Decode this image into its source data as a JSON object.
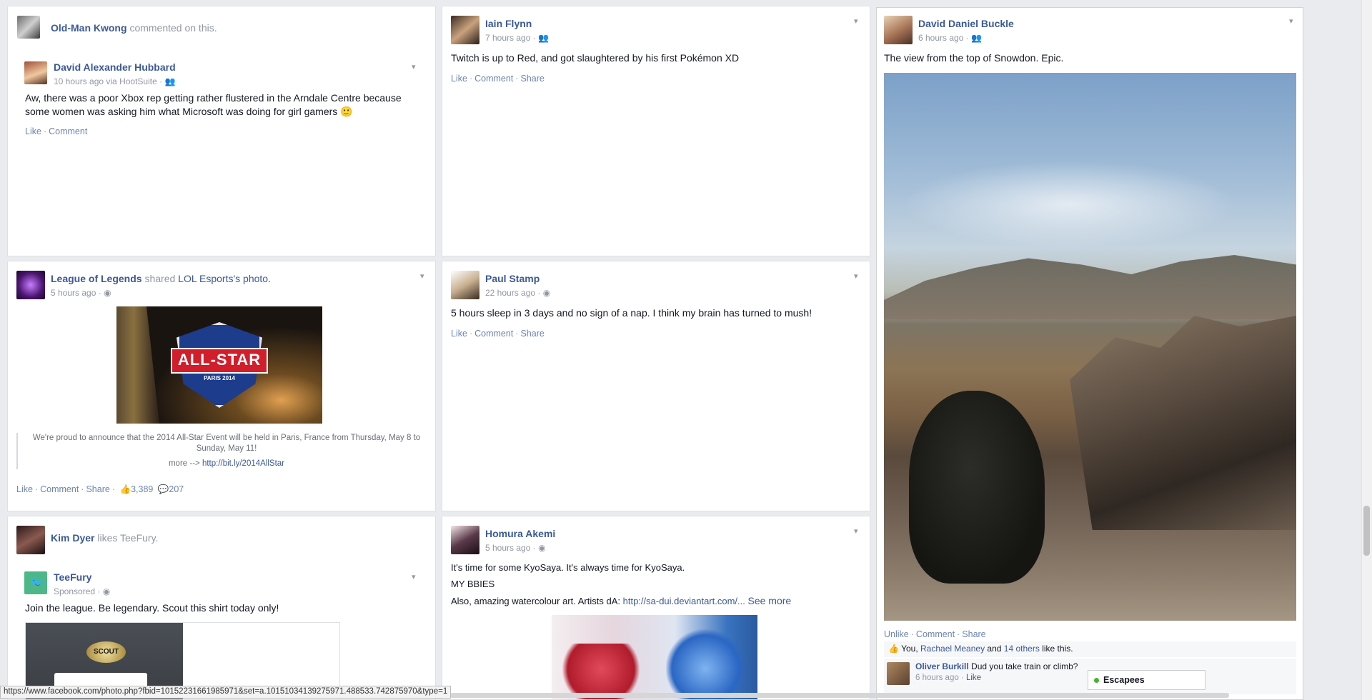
{
  "feed": {
    "c1": {
      "actor": "Old-Man Kwong",
      "actor_action": "commented on this.",
      "author": "David Alexander Hubbard",
      "time": "10 hours ago via HootSuite ·",
      "text": "Aw, there was a poor Xbox rep getting rather flustered in the Arndale Centre because some women was asking him what Microsoft was doing for girl gamers 🙂",
      "actions": [
        "Like",
        "Comment"
      ]
    },
    "c2": {
      "author": "Iain Flynn",
      "time": "7 hours ago ·",
      "text": "Twitch is up to Red, and got slaughtered by his first Pokémon XD",
      "actions": [
        "Like",
        "Comment",
        "Share"
      ]
    },
    "c3": {
      "author": "David Daniel Buckle",
      "time": "6 hours ago ·",
      "text": "The view from the top of Snowdon. Epic.",
      "actions": [
        "Unlike",
        "Comment",
        "Share"
      ],
      "likes_you": "You,",
      "likes_name": "Rachael Meaney",
      "likes_and": "and",
      "likes_others": "14 others",
      "likes_suffix": "like this.",
      "comment_author": "Oliver Burkill",
      "comment_text": "Dud you take train or climb?",
      "comment_time": "6 hours ago ·",
      "comment_like": "Like"
    },
    "c4": {
      "page": "League of Legends",
      "shared_text": "shared",
      "shared_owner": "LOL Esports's",
      "shared_suffix": "photo.",
      "time": "5 hours ago ·",
      "logo_text": "ALL-STAR",
      "logo_sub": "PARIS 2014",
      "caption": "We're proud to announce that the 2014 All-Star Event will be held in Paris, France from Thursday, May 8 to Sunday, May 11!",
      "more_prefix": "more -->",
      "more_link": "http://bit.ly/2014AllStar",
      "actions": [
        "Like",
        "Comment",
        "Share"
      ],
      "like_count": "3,389",
      "comment_count": "207"
    },
    "c5": {
      "author": "Paul Stamp",
      "time": "22 hours ago ·",
      "text": "5 hours sleep in 3 days and no sign of a nap. I think my brain has turned to mush!",
      "actions": [
        "Like",
        "Comment",
        "Share"
      ]
    },
    "c6": {
      "actor": "Kim Dyer",
      "actor_action": "likes TeeFury.",
      "page": "TeeFury",
      "sponsored": "Sponsored ·",
      "text": "Join the league. Be legendary. Scout this shirt today only!",
      "shirt_text": "SCOUT"
    },
    "c7": {
      "author": "Homura Akemi",
      "time": "5 hours ago ·",
      "line1": "It's time for some KyoSaya. It's always time for KyoSaya.",
      "line2": "MY BBIES",
      "line3_prefix": "Also, amazing watercolour art. Artists dA:",
      "line3_link": "http://sa-dui.deviantart.com/...",
      "see_more": "See more"
    }
  },
  "status_url": "https://www.facebook.com/photo.php?fbid=10152231661985971&set=a.10151034139275971.488533.742875970&type=1",
  "chat": {
    "label": "Escapees"
  },
  "colors": {
    "link": "#3b5998",
    "meta": "#9197a3",
    "background": "#e9ebee"
  }
}
